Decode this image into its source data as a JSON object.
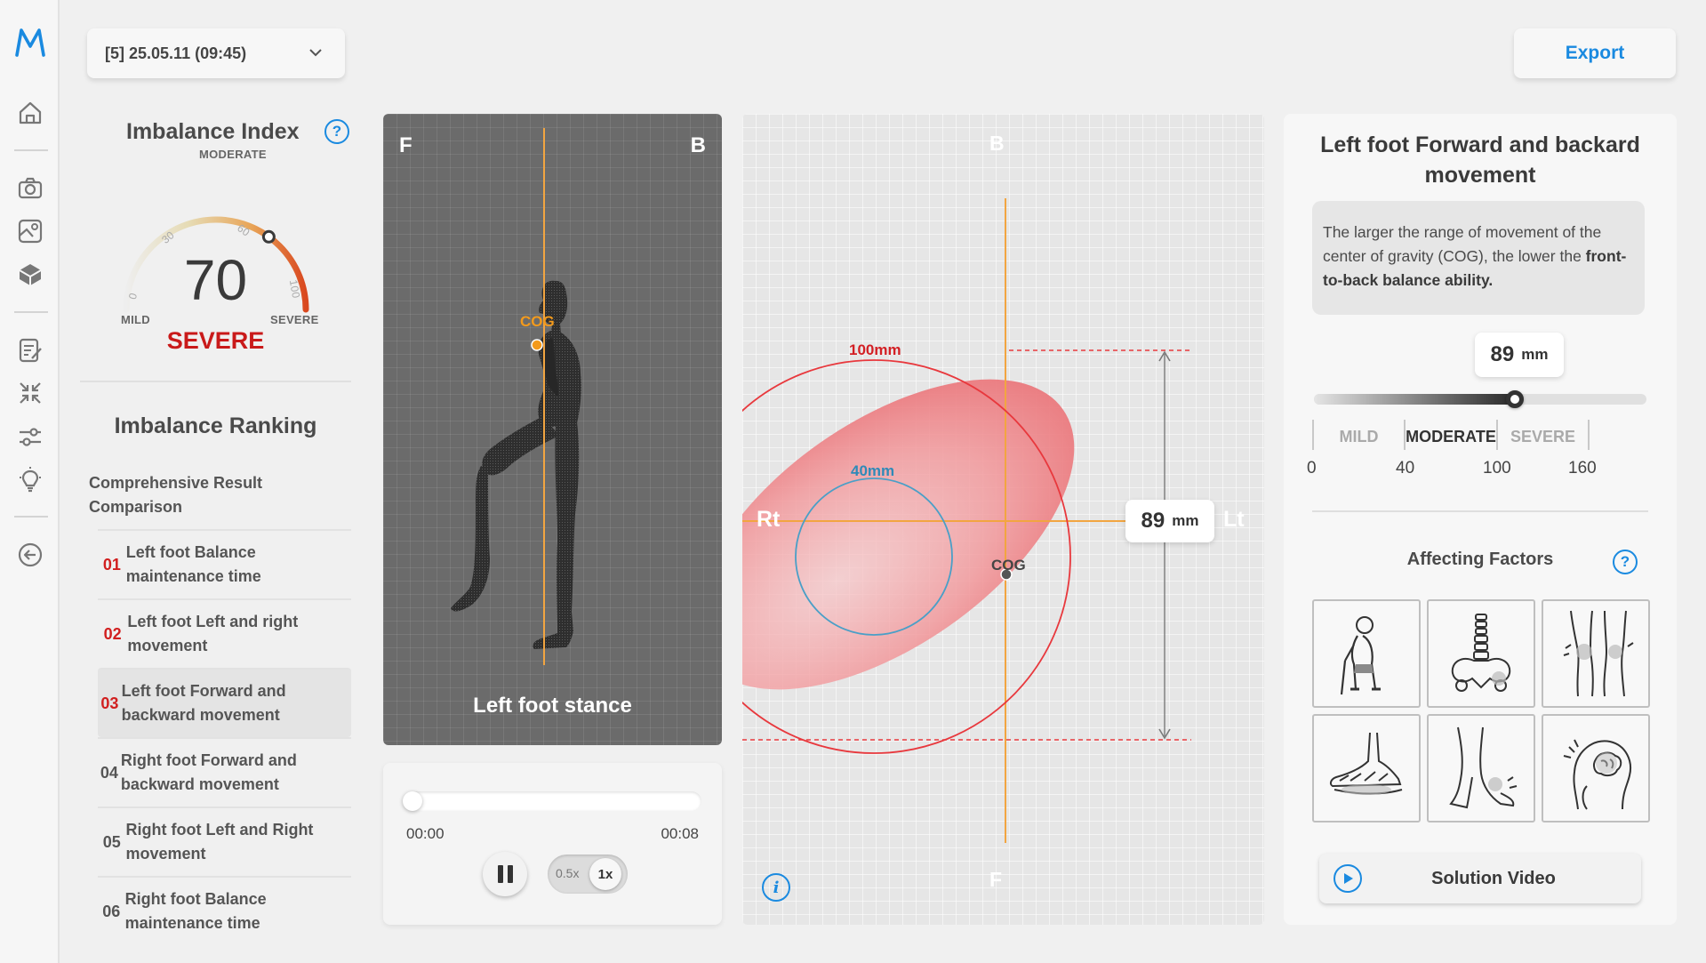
{
  "app": {
    "logo": "M"
  },
  "nav": {
    "icons": [
      "home-icon",
      "camera-icon",
      "gallery-icon",
      "cube-icon",
      "report-icon",
      "compress-icon",
      "sliders-icon",
      "bulb-icon",
      "back-icon"
    ]
  },
  "header": {
    "session_label": "[5] 25.05.11 (09:45)",
    "export_label": "Export"
  },
  "imbalance_index": {
    "title": "Imbalance Index",
    "help": "?",
    "value": "70",
    "level": "SEVERE",
    "gauge_labels": {
      "moderate": "MODERATE",
      "mild": "MILD",
      "severe": "SEVERE"
    },
    "gauge_ticks": [
      "0",
      "30",
      "60",
      "100"
    ],
    "gauge_value_fraction": 0.7,
    "colors": {
      "severe": "#c91a1a",
      "gauge_end": "#d9481f"
    }
  },
  "ranking": {
    "title": "Imbalance Ranking",
    "comprehensive": "Comprehensive Result Comparison",
    "items": [
      {
        "num": "01",
        "label": "Left foot Balance maintenance time",
        "highlight": true,
        "active": false
      },
      {
        "num": "02",
        "label": "Left foot Left and right movement",
        "highlight": true,
        "active": false
      },
      {
        "num": "03",
        "label": "Left foot Forward and backward movement",
        "highlight": true,
        "active": true
      },
      {
        "num": "04",
        "label": "Right foot Forward and backward movement",
        "highlight": false,
        "active": false
      },
      {
        "num": "05",
        "label": "Right foot Left and Right movement",
        "highlight": false,
        "active": false
      },
      {
        "num": "06",
        "label": "Right foot Balance maintenance time",
        "highlight": false,
        "active": false
      }
    ]
  },
  "stance": {
    "corner_left": "F",
    "corner_right": "B",
    "cog_label": "COG",
    "caption": "Left foot stance",
    "cog_color": "#f39a1c"
  },
  "player": {
    "time_start": "00:00",
    "time_end": "00:08",
    "speed_slow": "0.5x",
    "speed_normal": "1x",
    "progress_fraction": 0
  },
  "plot": {
    "top": "B",
    "bottom": "F",
    "left": "Rt",
    "right": "Lt",
    "outer_circle_label": "100mm",
    "inner_circle_label": "40mm",
    "cog_label": "COG",
    "measure_value": "89",
    "measure_unit": "mm",
    "info_icon": "info-icon",
    "colors": {
      "outer_circle": "#e8383d",
      "inner_circle": "#4a9fc7",
      "axis": "#f2a541",
      "ellipse": "#f08a8e"
    }
  },
  "detail": {
    "title": "Left foot Forward and backard movement",
    "desc_plain": "The larger the range of movement of the center of gravity (COG), the lower the ",
    "desc_bold": "front-to-back balance ability.",
    "value": "89",
    "unit": "mm",
    "slider_value": 89,
    "segments": [
      "MILD",
      "MODERATE",
      "SEVERE"
    ],
    "scale": [
      "0",
      "40",
      "100",
      "160"
    ],
    "affecting_title": "Affecting Factors",
    "help": "?",
    "factors": [
      "elderly-walking-cane-icon",
      "spine-pelvis-icon",
      "knee-pain-icon",
      "foot-arch-icon",
      "ankle-pain-icon",
      "head-brain-icon"
    ],
    "solution_label": "Solution Video",
    "accent": "#1a8ae0"
  }
}
